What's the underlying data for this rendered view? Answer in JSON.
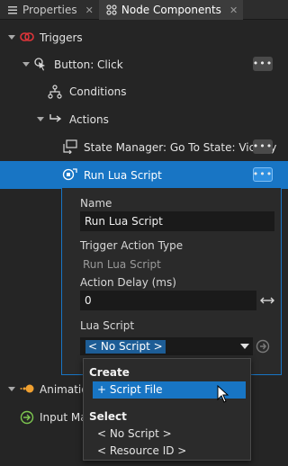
{
  "tabs": [
    {
      "label": "Properties",
      "close": "✕"
    },
    {
      "label": "Node Components",
      "close": "✕"
    }
  ],
  "tree": {
    "triggers": "Triggers",
    "button_click": "Button: Click",
    "conditions": "Conditions",
    "actions": "Actions",
    "state_manager": "State Manager: Go To State: Victory",
    "run_lua": "Run Lua Script",
    "animation": "Animatio",
    "input": "Input Ma"
  },
  "more_label": "•••",
  "details": {
    "name_label": "Name",
    "name_value": "Run Lua Script",
    "type_label": "Trigger Action Type",
    "type_value": "Run Lua Script",
    "delay_label": "Action Delay (ms)",
    "delay_value": "0",
    "script_label": "Lua Script",
    "script_value": "< No Script >"
  },
  "popup": {
    "create_header": "Create",
    "script_file": "+ Script File",
    "select_header": "Select",
    "no_script": "< No Script >",
    "resource_id": "< Resource ID >"
  },
  "colors": {
    "accent": "#1875c4",
    "panel": "#252525",
    "trigger_icon": "#e0353a",
    "animation_icon": "#f0a030",
    "input_icon": "#7ec850"
  }
}
